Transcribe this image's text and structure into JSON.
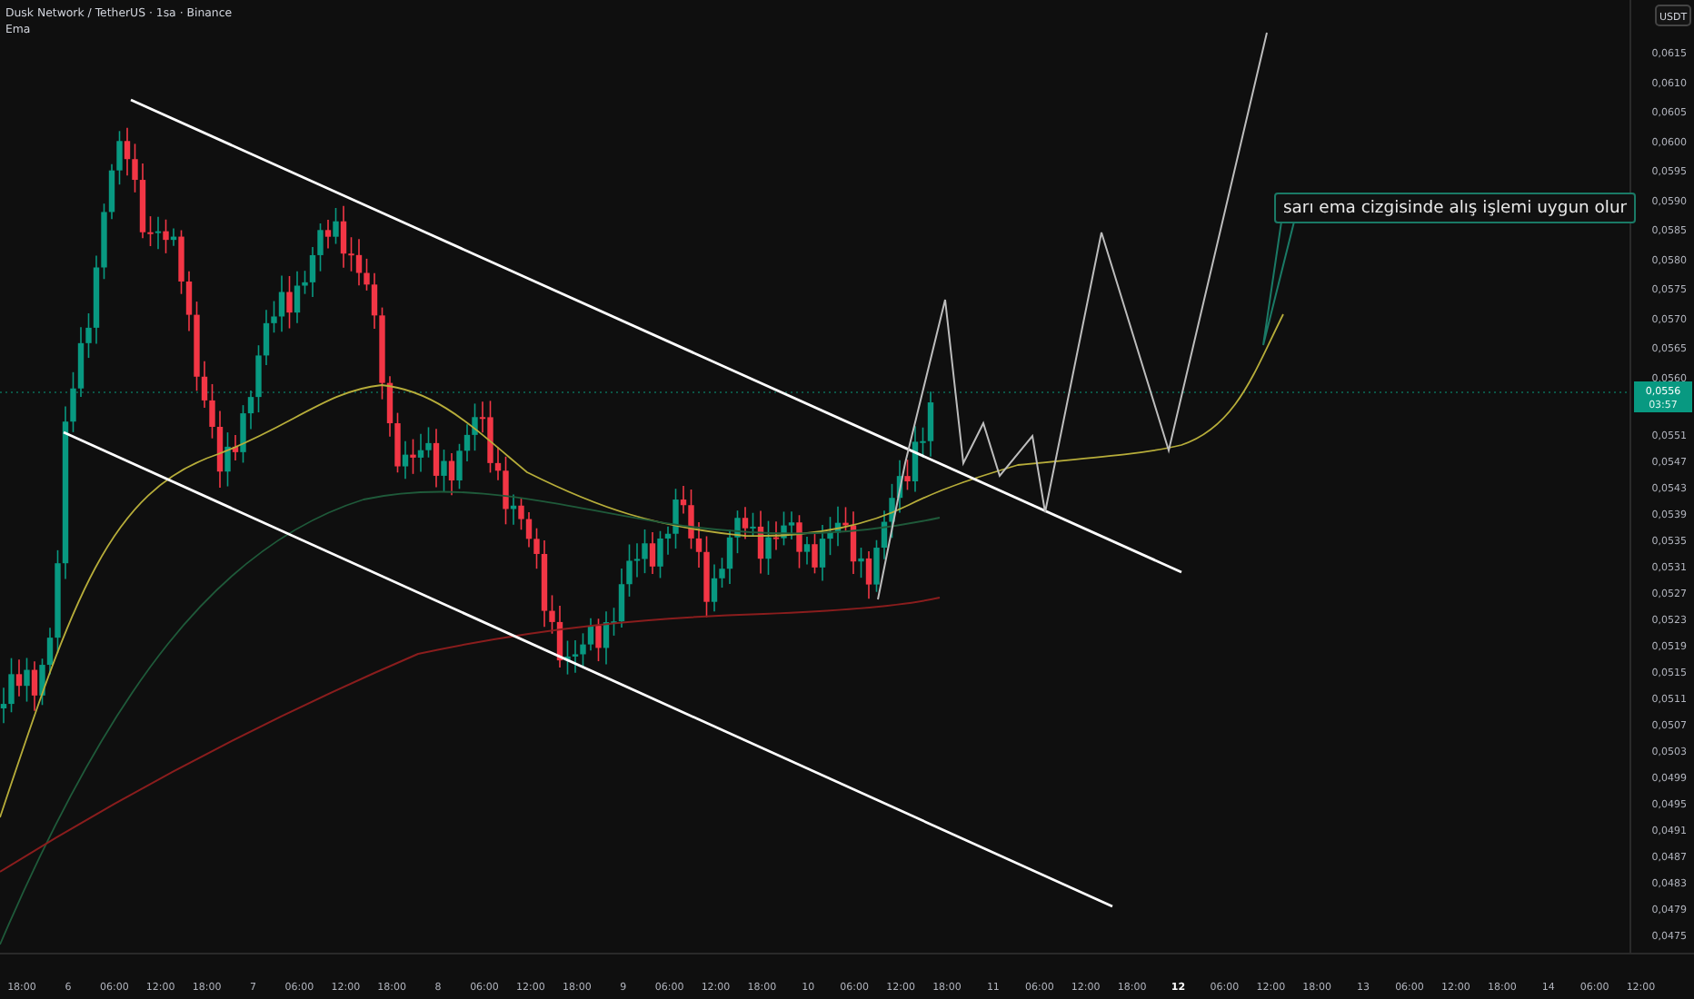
{
  "header": {
    "title": "Dusk Network / TetherUS · 1sa · Binance",
    "indicator": "Ema"
  },
  "price_axis": {
    "currency": "USDT",
    "ticks": [
      "0,0615",
      "0,0610",
      "0,0605",
      "0,0600",
      "0,0595",
      "0,0590",
      "0,0585",
      "0,0580",
      "0,0575",
      "0,0570",
      "0,0565",
      "0,0560",
      "0,0551",
      "0,0547",
      "0,0543",
      "0,0539",
      "0,0535",
      "0,0531",
      "0,0527",
      "0,0523",
      "0,0519",
      "0,0515",
      "0,0511",
      "0,0507",
      "0,0503",
      "0,0499",
      "0,0495",
      "0,0491",
      "0,0487",
      "0,0483",
      "0,0479",
      "0,0475"
    ],
    "last_price": "0,0556",
    "countdown": "03:57"
  },
  "time_axis": {
    "ticks": [
      {
        "label": "18:00",
        "emphasized": false
      },
      {
        "label": "6",
        "emphasized": false
      },
      {
        "label": "06:00",
        "emphasized": false
      },
      {
        "label": "12:00",
        "emphasized": false
      },
      {
        "label": "18:00",
        "emphasized": false
      },
      {
        "label": "7",
        "emphasized": false
      },
      {
        "label": "06:00",
        "emphasized": false
      },
      {
        "label": "12:00",
        "emphasized": false
      },
      {
        "label": "18:00",
        "emphasized": false
      },
      {
        "label": "8",
        "emphasized": false
      },
      {
        "label": "06:00",
        "emphasized": false
      },
      {
        "label": "12:00",
        "emphasized": false
      },
      {
        "label": "18:00",
        "emphasized": false
      },
      {
        "label": "9",
        "emphasized": false
      },
      {
        "label": "06:00",
        "emphasized": false
      },
      {
        "label": "12:00",
        "emphasized": false
      },
      {
        "label": "18:00",
        "emphasized": false
      },
      {
        "label": "10",
        "emphasized": false
      },
      {
        "label": "06:00",
        "emphasized": false
      },
      {
        "label": "12:00",
        "emphasized": false
      },
      {
        "label": "18:00",
        "emphasized": false
      },
      {
        "label": "11",
        "emphasized": false
      },
      {
        "label": "06:00",
        "emphasized": false
      },
      {
        "label": "12:00",
        "emphasized": false
      },
      {
        "label": "18:00",
        "emphasized": false
      },
      {
        "label": "12",
        "emphasized": true
      },
      {
        "label": "06:00",
        "emphasized": false
      },
      {
        "label": "12:00",
        "emphasized": false
      },
      {
        "label": "18:00",
        "emphasized": false
      },
      {
        "label": "13",
        "emphasized": false
      },
      {
        "label": "06:00",
        "emphasized": false
      },
      {
        "label": "12:00",
        "emphasized": false
      },
      {
        "label": "18:00",
        "emphasized": false
      },
      {
        "label": "14",
        "emphasized": false
      },
      {
        "label": "06:00",
        "emphasized": false
      },
      {
        "label": "12:00",
        "emphasized": false
      }
    ]
  },
  "annotation": {
    "text": "sarı ema cizgisinde alış işlemi uygun olur"
  }
}
